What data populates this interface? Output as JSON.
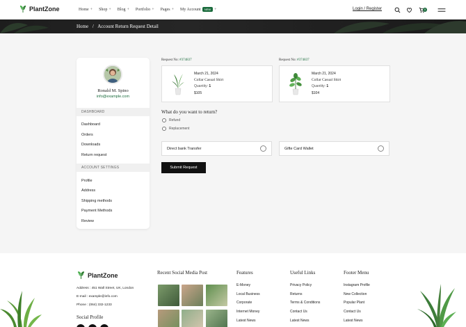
{
  "brand": {
    "name": "PlantZone",
    "accent": "#1a6b3c"
  },
  "nav": {
    "items": [
      {
        "label": "Home",
        "suffix": "+"
      },
      {
        "label": "Shop",
        "suffix": "+"
      },
      {
        "label": "Blog",
        "suffix": "+"
      },
      {
        "label": "Portfolio",
        "suffix": "+"
      },
      {
        "label": "Pages",
        "suffix": "+"
      },
      {
        "label": "My Account",
        "badge": "NEW",
        "suffix": "+"
      }
    ],
    "login": "Login / Register",
    "cart_count": "0"
  },
  "breadcrumb": {
    "home": "Home",
    "sep": "/",
    "current": "Account Return Request Detail"
  },
  "profile": {
    "name": "Ronald M. Spino",
    "email": "info@example.com"
  },
  "sidebar": {
    "dashboard_header": "DASHBOARD",
    "dashboard_items": [
      "Dashboard",
      "Orders",
      "Downloads",
      "Return request"
    ],
    "settings_header": "ACCOUNT SETTINGS",
    "settings_items": [
      "Profile",
      "Address",
      "Shipping methods",
      "Payment Methods",
      "Review"
    ]
  },
  "requests": [
    {
      "label": "Request No:",
      "number": "#374837",
      "date": "March 21, 2024",
      "product": "Collar Casual Shirt",
      "qty_label": "Quantity:",
      "qty": "1",
      "price": "$105"
    },
    {
      "label": "Request No:",
      "number": "#374837",
      "date": "March 21, 2024",
      "product": "Collar Casual Shirt",
      "qty_label": "Quantity:",
      "qty": "1",
      "price": "$104"
    }
  ],
  "return_form": {
    "question": "What do you want to return?",
    "options": [
      "Refund",
      "Replacement"
    ],
    "payments": [
      "Direct bank Transfer",
      "Gifte Card Wallet"
    ],
    "submit": "Submit Request"
  },
  "footer": {
    "address": "Address : 451 Wall Street, UK, London",
    "email": "E-mail : example@info.com",
    "phone": "Phone : (064) 332-1233",
    "social_title": "Social Profile",
    "social_post_title": "Recent Social Media Post",
    "features": {
      "title": "Features",
      "links": [
        "E-Money",
        "Local Business",
        "Corporate",
        "Internet Money",
        "Latest News"
      ]
    },
    "useful": {
      "title": "Useful Links",
      "links": [
        "Privacy Policy",
        "Returns",
        "Terms & Conditions",
        "Contact Us",
        "Latest News"
      ]
    },
    "menu": {
      "title": "Footer Menu",
      "links": [
        "Instagram Profile",
        "New Collection",
        "Popular Plant",
        "Contact Us",
        "Latest News"
      ]
    }
  }
}
